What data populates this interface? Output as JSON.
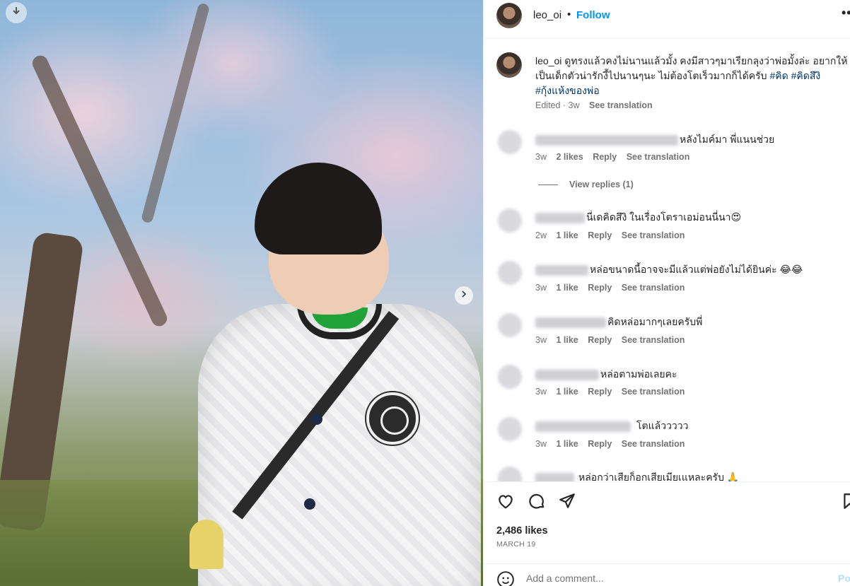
{
  "header": {
    "username": "leo_oi",
    "separator": "•",
    "follow_label": "Follow",
    "more_label": "•••"
  },
  "caption": {
    "username": "leo_oi",
    "text": "ดูทรงแล้วคงไม่นานแล้วมั้ง คงมีสาวๆมาเรียกลุงว่าพ่อมั้งล่ะ อยากให้เป็นเด็กตัวน่ารักงี้ไปนานๆนะ ไม่ต้องโตเร็วมากก็ได้ครับ",
    "tags": [
      "#คิด",
      "#คิดสึงิ",
      "#กุ้งแห้งของพ่อ"
    ],
    "edited": "Edited · 3w",
    "see_translation": "See translation"
  },
  "comments": [
    {
      "text": "หลังไมค์มา พี่แนนช่วย",
      "time": "3w",
      "likes": "2 likes",
      "reply": "Reply",
      "translate": "See translation"
    },
    {
      "text": "นี่เดคิดสึงิ ในเรื่องโตราเอม่อนนี่นา😍",
      "time": "2w",
      "likes": "1 like",
      "reply": "Reply",
      "translate": "See translation"
    },
    {
      "text": "หล่อขนาดนี้อาจจะมีแล้วแต่พ่อยังไม่ได้ยินค่ะ 😂😂",
      "time": "3w",
      "likes": "1 like",
      "reply": "Reply",
      "translate": "See translation"
    },
    {
      "text": "คิดหล่อมากๆเลยครับพี่",
      "time": "3w",
      "likes": "1 like",
      "reply": "Reply",
      "translate": "See translation"
    },
    {
      "text": "หล่อตามพ่อเลยคะ",
      "time": "3w",
      "likes": "1 like",
      "reply": "Reply",
      "translate": "See translation"
    },
    {
      "text": "โตแล้ววววว",
      "time": "3w",
      "likes": "1 like",
      "reply": "Reply",
      "translate": "See translation"
    },
    {
      "text": "หล่อกว่าเสียก็อกเสียเมียเแหละครับ 🙏",
      "time": "",
      "likes": "",
      "reply": "",
      "translate": ""
    }
  ],
  "view_replies": "View replies (1)",
  "footer": {
    "likes": "2,486 likes",
    "date": "MARCH 19",
    "add_comment_placeholder": "Add a comment...",
    "post_label": "Post"
  },
  "icons": [
    "download-icon",
    "next-arrow-icon",
    "heart-icon",
    "comment-icon",
    "share-icon",
    "bookmark-icon",
    "emoji-icon"
  ],
  "colors": {
    "accent": "#0095f6",
    "hashtag": "#00376b",
    "muted": "#737373"
  }
}
